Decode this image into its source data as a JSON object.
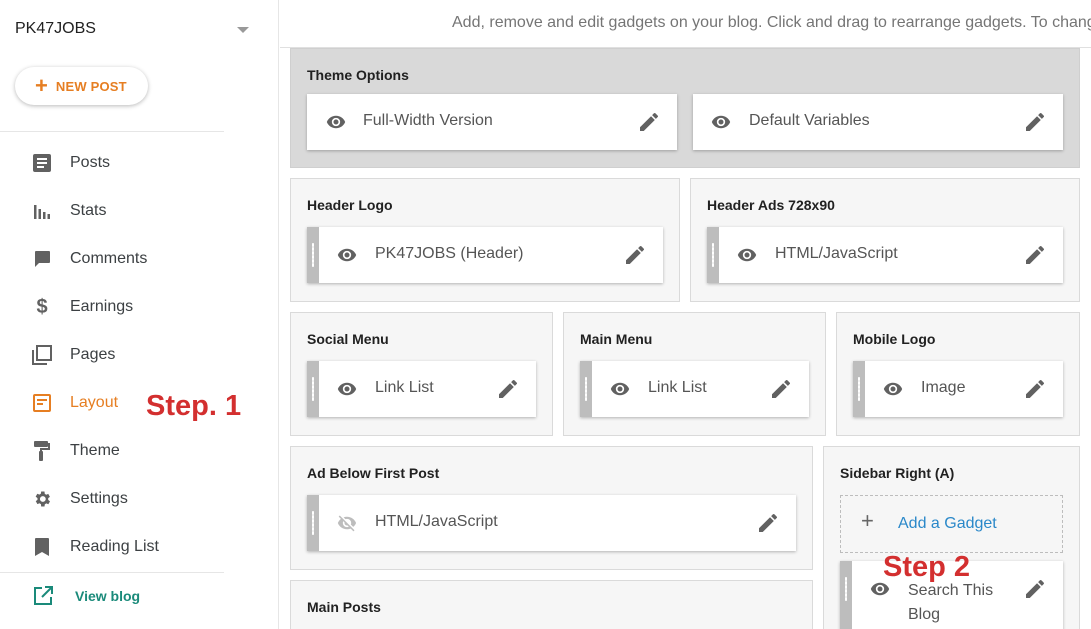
{
  "sidebar": {
    "blog_name": "PK47JOBS",
    "new_post_label": "NEW POST",
    "nav": [
      {
        "label": "Posts",
        "icon": "posts-icon"
      },
      {
        "label": "Stats",
        "icon": "stats-icon"
      },
      {
        "label": "Comments",
        "icon": "comments-icon"
      },
      {
        "label": "Earnings",
        "icon": "dollar-icon"
      },
      {
        "label": "Pages",
        "icon": "pages-icon"
      },
      {
        "label": "Layout",
        "icon": "layout-icon",
        "active": true
      },
      {
        "label": "Theme",
        "icon": "paint-roller-icon"
      },
      {
        "label": "Settings",
        "icon": "gear-icon"
      },
      {
        "label": "Reading List",
        "icon": "bookmark-icon"
      }
    ],
    "view_blog_label": "View blog",
    "step1_label": "Step. 1"
  },
  "main": {
    "instruction": "Add, remove and edit gadgets on your blog. Click and drag to rearrange gadgets. To change columns and widths, use the Theme Designer.",
    "sections": {
      "theme_options": {
        "title": "Theme Options",
        "gadgets": [
          "Full-Width Version",
          "Default Variables"
        ]
      },
      "header_logo": {
        "title": "Header Logo",
        "gadget": "PK47JOBS (Header)"
      },
      "header_ads": {
        "title": "Header Ads 728x90",
        "gadget": "HTML/JavaScript"
      },
      "social_menu": {
        "title": "Social Menu",
        "gadget": "Link List"
      },
      "main_menu": {
        "title": "Main Menu",
        "gadget": "Link List"
      },
      "mobile_logo": {
        "title": "Mobile Logo",
        "gadget": "Image"
      },
      "ad_below": {
        "title": "Ad Below First Post",
        "gadget": "HTML/JavaScript"
      },
      "sidebar_right": {
        "title": "Sidebar Right (A)",
        "add_label": "Add a Gadget",
        "gadget": "Search This Blog"
      },
      "main_posts": {
        "title": "Main Posts"
      }
    },
    "step2_label": "Step 2"
  },
  "colors": {
    "accent": "#e67e22",
    "link": "#2a88c9",
    "annotation": "#d32f2f",
    "view_blog": "#1a8a7a"
  }
}
